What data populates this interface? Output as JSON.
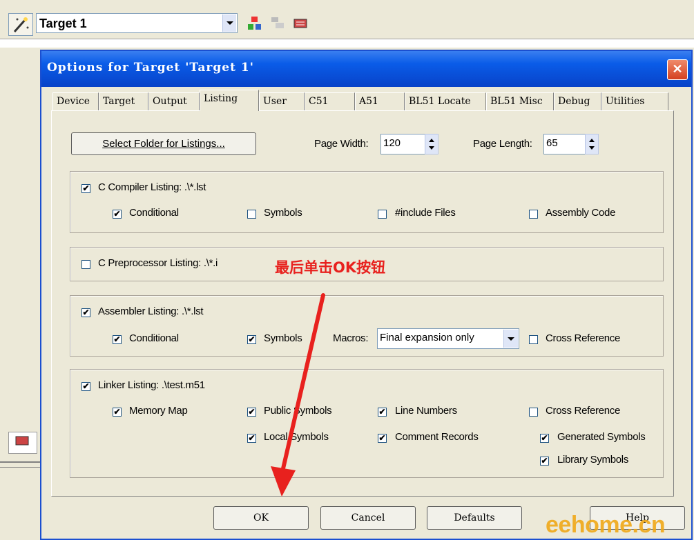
{
  "toolbar": {
    "target_combo_value": "Target 1"
  },
  "dialog": {
    "title": "Options for Target 'Target 1'",
    "close_glyph": "✕",
    "tabs": [
      "Device",
      "Target",
      "Output",
      "Listing",
      "User",
      "C51",
      "A51",
      "BL51 Locate",
      "BL51 Misc",
      "Debug",
      "Utilities"
    ],
    "active_tab": "Listing",
    "select_folder_label": "Select Folder for Listings...",
    "page_width_label": "Page Width:",
    "page_width_value": "120",
    "page_length_label": "Page Length:",
    "page_length_value": "65",
    "c_compiler": {
      "label": "C Compiler Listing:  .\\*.lst",
      "checked": true,
      "options": [
        {
          "label": "Conditional",
          "checked": true
        },
        {
          "label": "Symbols",
          "checked": false
        },
        {
          "label": "#include Files",
          "checked": false
        },
        {
          "label": "Assembly Code",
          "checked": false
        }
      ]
    },
    "c_preprocessor": {
      "label": "C Preprocessor Listing:  .\\*.i",
      "checked": false
    },
    "assembler": {
      "label": "Assembler Listing:  .\\*.lst",
      "checked": true,
      "conditional": {
        "label": "Conditional",
        "checked": true
      },
      "symbols": {
        "label": "Symbols",
        "checked": true
      },
      "macros_label": "Macros:",
      "macros_value": "Final expansion only",
      "cross_reference": {
        "label": "Cross Reference",
        "checked": false
      }
    },
    "linker": {
      "label": "Linker Listing:  .\\test.m51",
      "checked": true,
      "options": [
        {
          "label": "Memory Map",
          "checked": true
        },
        {
          "label": "Public Symbols",
          "checked": true
        },
        {
          "label": "Line Numbers",
          "checked": true
        },
        {
          "label": "Cross Reference",
          "checked": false
        },
        {
          "label": "Local Symbols",
          "checked": true
        },
        {
          "label": "Comment Records",
          "checked": true
        },
        {
          "label": "Generated Symbols",
          "checked": true
        },
        {
          "label": "Library Symbols",
          "checked": true
        }
      ]
    },
    "buttons": {
      "ok": "OK",
      "cancel": "Cancel",
      "defaults": "Defaults",
      "help": "Help"
    }
  },
  "annotation": {
    "text": "最后单击OK按钮",
    "color": "#e8211e"
  },
  "watermark": "eehome.cn",
  "check_glyph": "✔"
}
